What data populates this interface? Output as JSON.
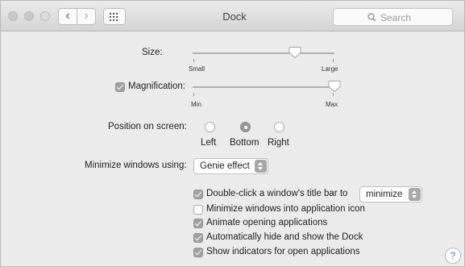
{
  "window": {
    "title": "Dock"
  },
  "toolbar": {
    "back_glyph": "‹",
    "forward_glyph": "›",
    "search_placeholder": "Search",
    "search_icon": "magnifier-icon",
    "grid_icon": "show-all-grid-icon"
  },
  "size": {
    "label": "Size:",
    "min_label": "Small",
    "max_label": "Large",
    "value": 0.72
  },
  "magnification": {
    "label": "Magnification:",
    "checked": true,
    "min_label": "Min",
    "max_label": "Max",
    "value": 1.0
  },
  "position": {
    "label": "Position on screen:",
    "options": [
      "Left",
      "Bottom",
      "Right"
    ],
    "selected": "Bottom"
  },
  "minimize": {
    "label": "Minimize windows using:",
    "value": "Genie effect"
  },
  "options": [
    {
      "label": "Double-click a window's title bar to",
      "checked": true,
      "popup": "minimize"
    },
    {
      "label": "Minimize windows into application icon",
      "checked": false
    },
    {
      "label": "Animate opening applications",
      "checked": true
    },
    {
      "label": "Automatically hide and show the Dock",
      "checked": true
    },
    {
      "label": "Show indicators for open applications",
      "checked": true
    }
  ],
  "help": {
    "glyph": "?"
  }
}
